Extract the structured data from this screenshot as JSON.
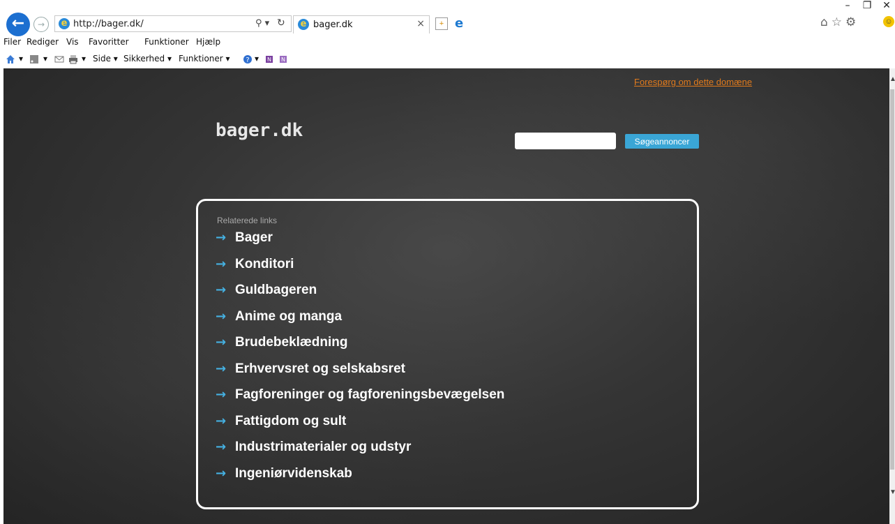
{
  "window": {
    "minimize": "–",
    "restore": "❐",
    "close": "✕"
  },
  "browser": {
    "address": "http://bager.dk/",
    "address_search_symbol": "⚲ ▾",
    "address_refresh_symbol": "↻",
    "tab_title": "bager.dk",
    "tab_close": "×"
  },
  "menu": {
    "items": [
      "Filer",
      "Rediger",
      "Vis",
      "Favoritter",
      "Funktioner",
      "Hjælp"
    ]
  },
  "commandbar": {
    "home_dropdown": "▾",
    "feeds_dropdown": "▾",
    "print_dropdown": "▾",
    "page_label": "Side ▾",
    "safety_label": "Sikkerhed ▾",
    "tools_label": "Funktioner ▾",
    "help_dropdown": "▾"
  },
  "page": {
    "inquiry_link": "Forespørg om dette domæne",
    "logo": "bager.dk",
    "search": {
      "placeholder": "",
      "button_label": "Søgeannoncer"
    },
    "links_header": "Relaterede links",
    "links": [
      "Bager",
      "Konditori",
      "Guldbageren",
      "Anime og manga",
      "Brudebeklædning",
      "Erhvervsret og selskabsret",
      "Fagforeninger og fagforeningsbevægelsen",
      "Fattigdom og sult",
      "Industrimaterialer og udstyr",
      "Ingeniørvidenskab"
    ],
    "arrow_symbol": "→"
  },
  "colors": {
    "background": "#333333",
    "accent_blue": "#3aa6d6",
    "link_orange": "#e07a1c",
    "arrow_blue": "#45b1e2"
  }
}
